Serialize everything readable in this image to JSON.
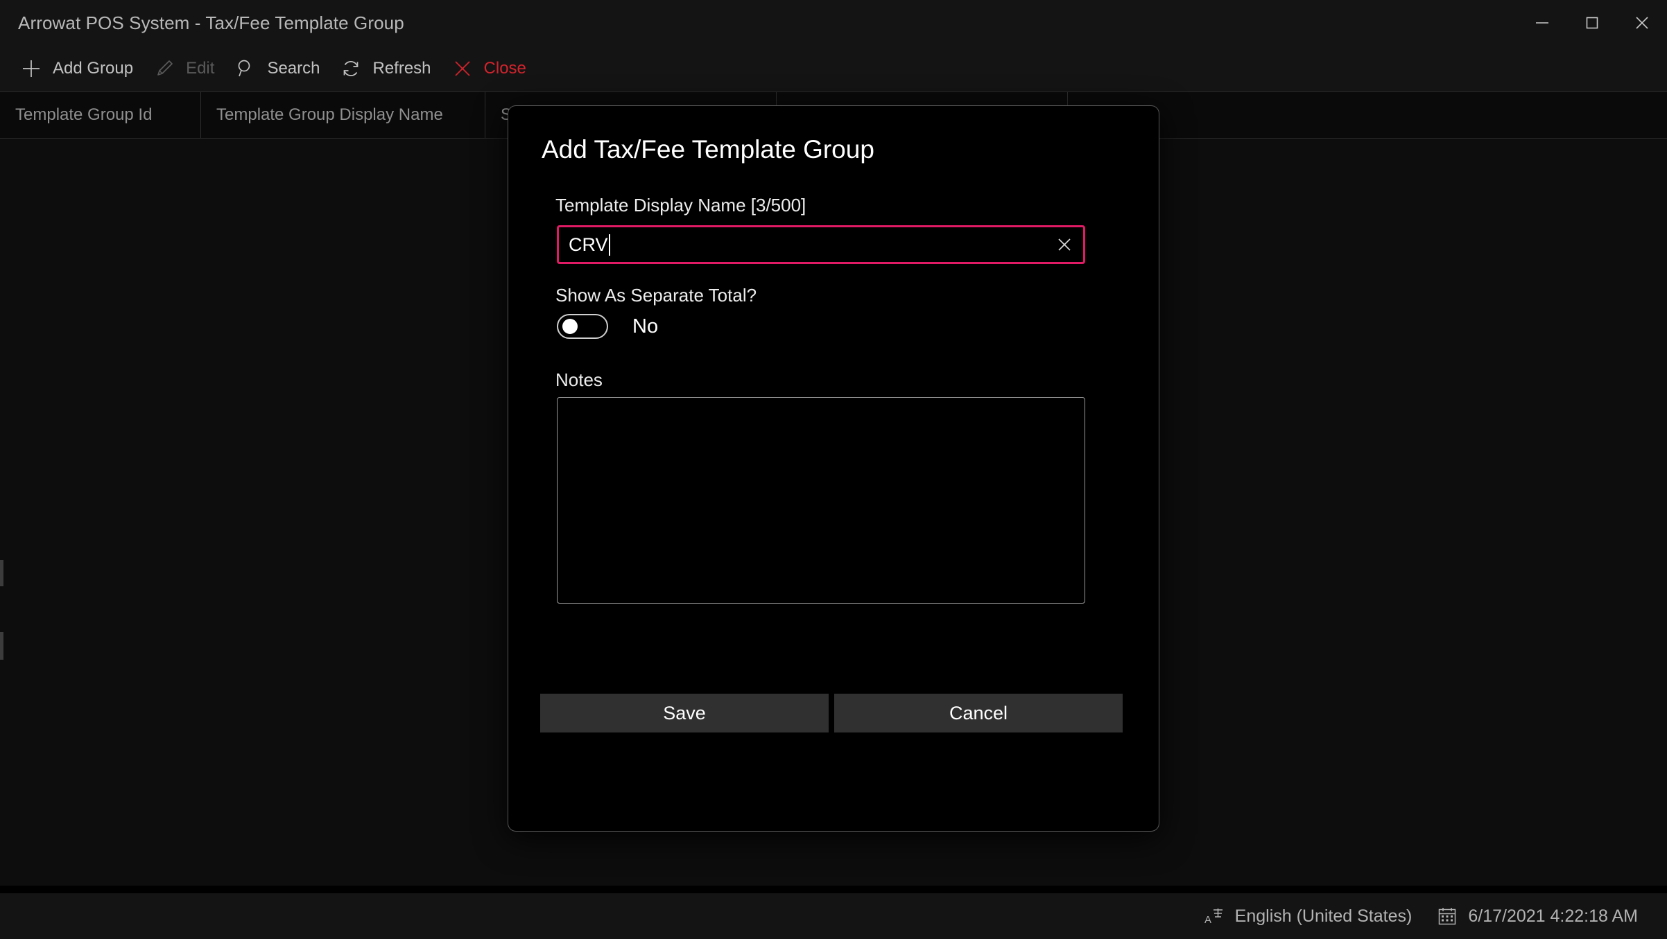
{
  "window": {
    "title": "Arrowat POS System - Tax/Fee Template Group",
    "controls": {
      "minimize": "minimize-button",
      "maximize": "maximize-button",
      "close": "close-button"
    }
  },
  "toolbar": {
    "items": [
      {
        "label": "Add Group",
        "icon": "plus-icon",
        "state": "enabled"
      },
      {
        "label": "Edit",
        "icon": "pencil-icon",
        "state": "disabled"
      },
      {
        "label": "Search",
        "icon": "search-icon",
        "state": "enabled"
      },
      {
        "label": "Refresh",
        "icon": "refresh-icon",
        "state": "enabled"
      },
      {
        "label": "Close",
        "icon": "x-icon",
        "state": "danger"
      }
    ]
  },
  "grid": {
    "columns": [
      {
        "header": "Template Group Id"
      },
      {
        "header": "Template Group Display Name"
      },
      {
        "header": "S"
      },
      {
        "header": ""
      },
      {
        "header": ""
      }
    ],
    "rows": []
  },
  "dialog": {
    "title": "Add Tax/Fee Template Group",
    "name_field": {
      "label": "Template Display Name [3/500]",
      "value": "CRV",
      "placeholder": "",
      "clear_icon": "close-icon",
      "border_color": "#e01a64"
    },
    "separate_total": {
      "label": "Show As Separate Total?",
      "state_label": "No",
      "checked": false
    },
    "notes": {
      "label": "Notes",
      "value": "",
      "placeholder": ""
    },
    "buttons": {
      "save": "Save",
      "cancel": "Cancel"
    }
  },
  "statusbar": {
    "language": "English (United States)",
    "language_icon": "language-icon",
    "datetime": "6/17/2021 4:22:18 AM",
    "datetime_icon": "calendar-icon"
  }
}
